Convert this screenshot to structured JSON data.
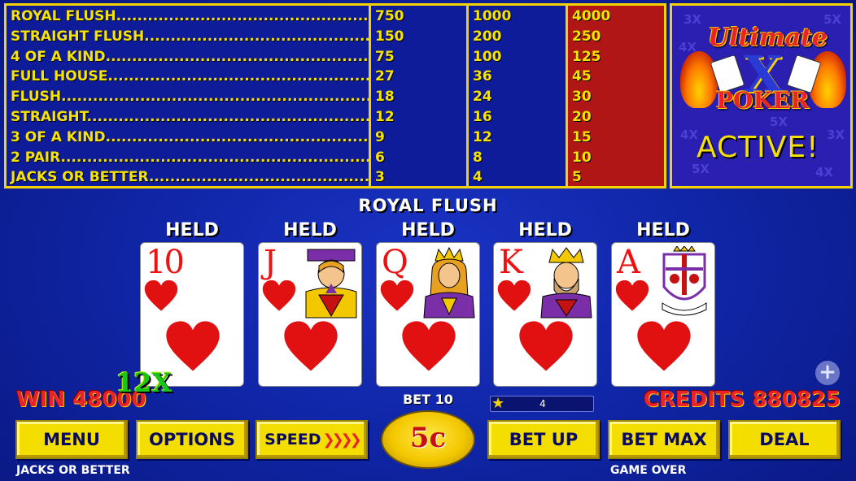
{
  "paytable": {
    "hands": [
      "ROYAL FLUSH",
      "STRAIGHT FLUSH",
      "4 OF A KIND",
      "FULL HOUSE",
      "FLUSH",
      "STRAIGHT",
      "3 OF A KIND",
      "2 PAIR",
      "JACKS OR BETTER"
    ],
    "col1": [
      "750",
      "150",
      "75",
      "27",
      "18",
      "12",
      "9",
      "6",
      "3"
    ],
    "col2": [
      "1000",
      "200",
      "100",
      "36",
      "24",
      "16",
      "12",
      "8",
      "4"
    ],
    "col3": [
      "4000",
      "250",
      "125",
      "45",
      "30",
      "20",
      "15",
      "10",
      "5"
    ]
  },
  "ultimate_x": {
    "title_top": "Ultimate",
    "title_x": "X",
    "title_bottom": "POKER",
    "status": "ACTIVE!",
    "bg_multipliers": [
      "3X",
      "5X",
      "4X",
      "5X",
      "4X",
      "3X",
      "5X",
      "4X"
    ]
  },
  "hand_result": "ROYAL FLUSH",
  "cards": [
    {
      "rank": "10",
      "suit": "hearts",
      "held": "HELD",
      "face": ""
    },
    {
      "rank": "J",
      "suit": "hearts",
      "held": "HELD",
      "face": "jack"
    },
    {
      "rank": "Q",
      "suit": "hearts",
      "held": "HELD",
      "face": "queen"
    },
    {
      "rank": "K",
      "suit": "hearts",
      "held": "HELD",
      "face": "king"
    },
    {
      "rank": "A",
      "suit": "hearts",
      "held": "HELD",
      "face": "ace"
    }
  ],
  "win_text": "WIN 48000",
  "multiplier_badge": "12X",
  "bet_text": "BET 10",
  "level": "4",
  "credits_text": "CREDITS 880825",
  "plus_label": "+",
  "buttons": {
    "menu": "MENU",
    "options": "OPTIONS",
    "speed": "SPEED",
    "speed_arrows": "❯❯❯❯",
    "denomination": "5c",
    "bet_up": "BET UP",
    "bet_max": "BET MAX",
    "deal": "DEAL"
  },
  "game_name": "JACKS OR BETTER",
  "game_status": "GAME OVER",
  "colors": {
    "accent_yellow": "#f5d300",
    "paytable_red": "#b01616",
    "heart_red": "#e11111",
    "bg_blue": "#1026a8"
  }
}
